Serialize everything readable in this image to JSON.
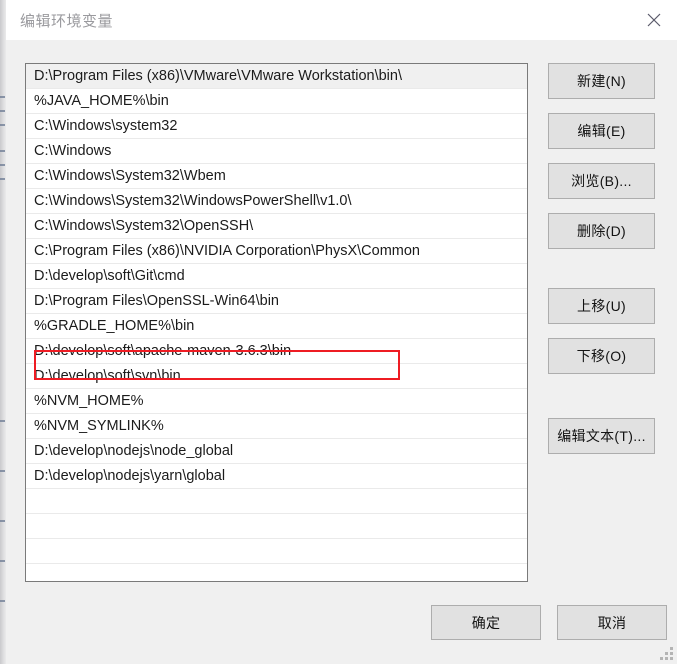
{
  "window": {
    "title": "编辑环境变量",
    "close_icon": "close-icon",
    "resize_grip_icon": "resize-grip-icon"
  },
  "path_list": {
    "selected_index": 0,
    "highlighted_index": 11,
    "entries": [
      "D:\\Program Files (x86)\\VMware\\VMware Workstation\\bin\\",
      "%JAVA_HOME%\\bin",
      "C:\\Windows\\system32",
      "C:\\Windows",
      "C:\\Windows\\System32\\Wbem",
      "C:\\Windows\\System32\\WindowsPowerShell\\v1.0\\",
      "C:\\Windows\\System32\\OpenSSH\\",
      "C:\\Program Files (x86)\\NVIDIA Corporation\\PhysX\\Common",
      "D:\\develop\\soft\\Git\\cmd",
      "D:\\Program Files\\OpenSSL-Win64\\bin",
      "%GRADLE_HOME%\\bin",
      "D:\\develop\\soft\\apache-maven-3.6.3\\bin",
      "D:\\develop\\soft\\svn\\bin",
      "%NVM_HOME%",
      "%NVM_SYMLINK%",
      "D:\\develop\\nodejs\\node_global",
      "D:\\develop\\nodejs\\yarn\\global"
    ],
    "empty_row_count": 5
  },
  "side_buttons": {
    "new": "新建(N)",
    "edit": "编辑(E)",
    "browse": "浏览(B)...",
    "delete": "删除(D)",
    "move_up": "上移(U)",
    "move_down": "下移(O)",
    "edit_text": "编辑文本(T)..."
  },
  "bottom_buttons": {
    "ok": "确定",
    "cancel": "取消"
  },
  "colors": {
    "annotation": "#ee1c23",
    "dialog_bg": "#f0f0f0",
    "button_face": "#e1e1e1",
    "selected_row": "#f0f0f0"
  }
}
